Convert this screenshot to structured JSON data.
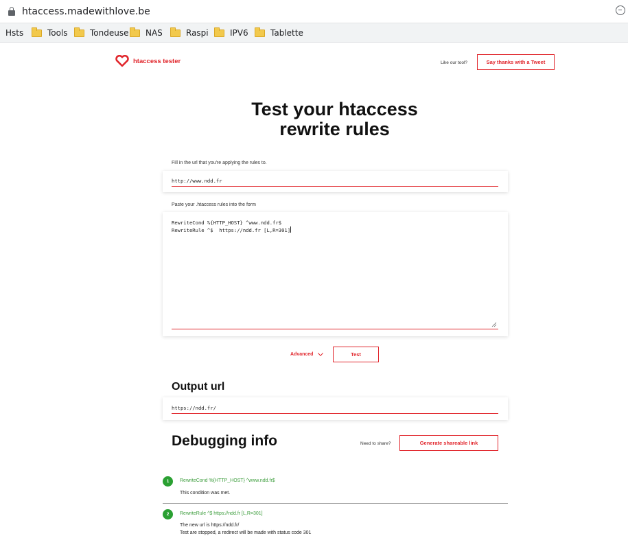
{
  "browser": {
    "url": "htaccess.madewithlove.be",
    "bookmarks": [
      "Hsts",
      "Tools",
      "Tondeuse",
      "NAS",
      "Raspi",
      "IPV6",
      "Tablette"
    ]
  },
  "header": {
    "logo_text": "htaccess tester",
    "like_label": "Like our tool?",
    "tweet_button": "Say thanks with a Tweet"
  },
  "main": {
    "title_line1": "Test your htaccess",
    "title_line2": "rewrite rules",
    "url_label": "Fill in the url that you're applying the rules to.",
    "url_value": "http://www.ndd.fr",
    "rules_label": "Paste your .htaccess rules into the form",
    "rules_line1": "RewriteCond %{HTTP_HOST} ^www.ndd.fr$",
    "rules_line2": "RewriteRule ^$  https://ndd.fr [L,R=301]",
    "advanced_label": "Advanced",
    "test_button": "Test"
  },
  "output": {
    "heading": "Output url",
    "value": "https://ndd.fr/"
  },
  "debug": {
    "heading": "Debugging info",
    "share_label": "Need to share?",
    "share_button": "Generate shareable link",
    "steps": [
      {
        "num": "1",
        "rule": "RewriteCond %{HTTP_HOST} ^www.ndd.fr$",
        "msg1": "This condition was met.",
        "msg2": ""
      },
      {
        "num": "2",
        "rule": "RewriteRule ^$ https://ndd.fr [L,R=301]",
        "msg1": "The new url is https://ndd.fr/",
        "msg2": "Test are stopped, a redirect will be made with status code 301"
      }
    ]
  },
  "colors": {
    "accent": "#e1262c",
    "success": "#2aa032"
  }
}
